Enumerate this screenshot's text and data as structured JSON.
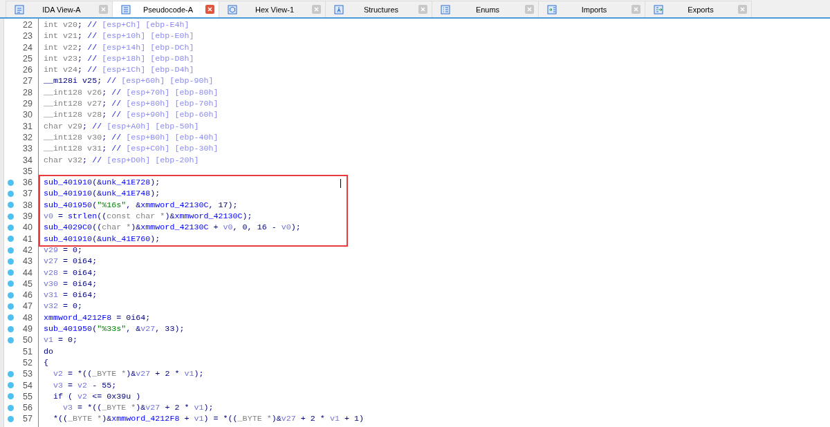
{
  "tabs": [
    {
      "label": "IDA View-A",
      "selected": false
    },
    {
      "label": "Pseudocode-A",
      "selected": true
    },
    {
      "label": "Hex View-1",
      "selected": false
    },
    {
      "label": "Structures",
      "selected": false
    },
    {
      "label": "Enums",
      "selected": false
    },
    {
      "label": "Imports",
      "selected": false
    },
    {
      "label": "Exports",
      "selected": false
    }
  ],
  "lines": [
    {
      "number": "22",
      "dot": false,
      "boxed": false,
      "tokens": [
        {
          "kind": "decl",
          "text": "int v20"
        },
        {
          "kind": "punct",
          "text": "; "
        },
        {
          "kind": "comment",
          "text": "// "
        },
        {
          "kind": "offset",
          "text": "[esp+Ch] [ebp-E4h]"
        }
      ]
    },
    {
      "number": "23",
      "dot": false,
      "boxed": false,
      "tokens": [
        {
          "kind": "decl",
          "text": "int v21"
        },
        {
          "kind": "punct",
          "text": "; "
        },
        {
          "kind": "comment",
          "text": "// "
        },
        {
          "kind": "offset",
          "text": "[esp+10h] [ebp-E0h]"
        }
      ]
    },
    {
      "number": "24",
      "dot": false,
      "boxed": false,
      "tokens": [
        {
          "kind": "decl",
          "text": "int v22"
        },
        {
          "kind": "punct",
          "text": "; "
        },
        {
          "kind": "comment",
          "text": "// "
        },
        {
          "kind": "offset",
          "text": "[esp+14h] [ebp-DCh]"
        }
      ]
    },
    {
      "number": "25",
      "dot": false,
      "boxed": false,
      "tokens": [
        {
          "kind": "decl",
          "text": "int v23"
        },
        {
          "kind": "punct",
          "text": "; "
        },
        {
          "kind": "comment",
          "text": "// "
        },
        {
          "kind": "offset",
          "text": "[esp+18h] [ebp-D8h]"
        }
      ]
    },
    {
      "number": "26",
      "dot": false,
      "boxed": false,
      "tokens": [
        {
          "kind": "decl",
          "text": "int v24"
        },
        {
          "kind": "punct",
          "text": "; "
        },
        {
          "kind": "comment",
          "text": "// "
        },
        {
          "kind": "offset",
          "text": "[esp+1Ch] [ebp-D4h]"
        }
      ]
    },
    {
      "number": "27",
      "dot": false,
      "boxed": false,
      "tokens": [
        {
          "kind": "punct",
          "text": "__m128i v25; "
        },
        {
          "kind": "comment",
          "text": "// "
        },
        {
          "kind": "offset",
          "text": "[esp+60h] [ebp-90h]"
        }
      ]
    },
    {
      "number": "28",
      "dot": false,
      "boxed": false,
      "tokens": [
        {
          "kind": "decl",
          "text": "__int128 v26"
        },
        {
          "kind": "punct",
          "text": "; "
        },
        {
          "kind": "comment",
          "text": "// "
        },
        {
          "kind": "offset",
          "text": "[esp+70h] [ebp-80h]"
        }
      ]
    },
    {
      "number": "29",
      "dot": false,
      "boxed": false,
      "tokens": [
        {
          "kind": "decl",
          "text": "__int128 v27"
        },
        {
          "kind": "punct",
          "text": "; "
        },
        {
          "kind": "comment",
          "text": "// "
        },
        {
          "kind": "offset",
          "text": "[esp+80h] [ebp-70h]"
        }
      ]
    },
    {
      "number": "30",
      "dot": false,
      "boxed": false,
      "tokens": [
        {
          "kind": "decl",
          "text": "__int128 v28"
        },
        {
          "kind": "punct",
          "text": "; "
        },
        {
          "kind": "comment",
          "text": "// "
        },
        {
          "kind": "offset",
          "text": "[esp+90h] [ebp-60h]"
        }
      ]
    },
    {
      "number": "31",
      "dot": false,
      "boxed": false,
      "tokens": [
        {
          "kind": "decl",
          "text": "char v29"
        },
        {
          "kind": "punct",
          "text": "; "
        },
        {
          "kind": "comment",
          "text": "// "
        },
        {
          "kind": "offset",
          "text": "[esp+A0h] [ebp-50h]"
        }
      ]
    },
    {
      "number": "32",
      "dot": false,
      "boxed": false,
      "tokens": [
        {
          "kind": "decl",
          "text": "__int128 v30"
        },
        {
          "kind": "punct",
          "text": "; "
        },
        {
          "kind": "comment",
          "text": "// "
        },
        {
          "kind": "offset",
          "text": "[esp+B0h] [ebp-40h]"
        }
      ]
    },
    {
      "number": "33",
      "dot": false,
      "boxed": false,
      "tokens": [
        {
          "kind": "decl",
          "text": "__int128 v31"
        },
        {
          "kind": "punct",
          "text": "; "
        },
        {
          "kind": "comment",
          "text": "// "
        },
        {
          "kind": "offset",
          "text": "[esp+C0h] [ebp-30h]"
        }
      ]
    },
    {
      "number": "34",
      "dot": false,
      "boxed": false,
      "tokens": [
        {
          "kind": "decl",
          "text": "char v32"
        },
        {
          "kind": "punct",
          "text": "; "
        },
        {
          "kind": "comment",
          "text": "// "
        },
        {
          "kind": "offset",
          "text": "[esp+D0h] [ebp-20h]"
        }
      ]
    },
    {
      "number": "35",
      "dot": false,
      "boxed": false
    },
    {
      "number": "36",
      "dot": true,
      "boxed": true,
      "tokens": [
        {
          "kind": "name",
          "text": "sub_401910"
        },
        {
          "kind": "punct",
          "text": "(&"
        },
        {
          "kind": "name",
          "text": "unk_41E728"
        },
        {
          "kind": "punct",
          "text": ");"
        }
      ]
    },
    {
      "number": "37",
      "dot": true,
      "boxed": true,
      "tokens": [
        {
          "kind": "name",
          "text": "sub_401910"
        },
        {
          "kind": "punct",
          "text": "(&"
        },
        {
          "kind": "name",
          "text": "unk_41E748"
        },
        {
          "kind": "punct",
          "text": ");"
        }
      ]
    },
    {
      "number": "38",
      "dot": true,
      "boxed": true,
      "tokens": [
        {
          "kind": "name",
          "text": "sub_401950"
        },
        {
          "kind": "punct",
          "text": "("
        },
        {
          "kind": "string",
          "text": "\"%16s\""
        },
        {
          "kind": "punct",
          "text": ", &"
        },
        {
          "kind": "name",
          "text": "xmmword_42130C"
        },
        {
          "kind": "punct",
          "text": ", 17);"
        }
      ]
    },
    {
      "number": "39",
      "dot": true,
      "boxed": true,
      "tokens": [
        {
          "kind": "var",
          "text": "v0"
        },
        {
          "kind": "punct",
          "text": " = "
        },
        {
          "kind": "name",
          "text": "strlen"
        },
        {
          "kind": "punct",
          "text": "(("
        },
        {
          "kind": "decl",
          "text": "const char *"
        },
        {
          "kind": "punct",
          "text": ")&"
        },
        {
          "kind": "name",
          "text": "xmmword_42130C"
        },
        {
          "kind": "punct",
          "text": ");"
        }
      ]
    },
    {
      "number": "40",
      "dot": true,
      "boxed": true,
      "tokens": [
        {
          "kind": "name",
          "text": "sub_4029C0"
        },
        {
          "kind": "punct",
          "text": "(("
        },
        {
          "kind": "decl",
          "text": "char *"
        },
        {
          "kind": "punct",
          "text": ")&"
        },
        {
          "kind": "name",
          "text": "xmmword_42130C"
        },
        {
          "kind": "punct",
          "text": " + "
        },
        {
          "kind": "var",
          "text": "v0"
        },
        {
          "kind": "punct",
          "text": ", 0, 16 - "
        },
        {
          "kind": "var",
          "text": "v0"
        },
        {
          "kind": "punct",
          "text": ");"
        }
      ]
    },
    {
      "number": "41",
      "dot": true,
      "boxed": true,
      "tokens": [
        {
          "kind": "name",
          "text": "sub_401910"
        },
        {
          "kind": "punct",
          "text": "(&"
        },
        {
          "kind": "name",
          "text": "unk_41E760"
        },
        {
          "kind": "punct",
          "text": ");"
        }
      ]
    },
    {
      "number": "42",
      "dot": true,
      "boxed": false,
      "tokens": [
        {
          "kind": "var",
          "text": "v29"
        },
        {
          "kind": "punct",
          "text": " = 0;"
        }
      ]
    },
    {
      "number": "43",
      "dot": true,
      "boxed": false,
      "tokens": [
        {
          "kind": "var",
          "text": "v27"
        },
        {
          "kind": "punct",
          "text": " = 0i64;"
        }
      ]
    },
    {
      "number": "44",
      "dot": true,
      "boxed": false,
      "tokens": [
        {
          "kind": "var",
          "text": "v28"
        },
        {
          "kind": "punct",
          "text": " = 0i64;"
        }
      ]
    },
    {
      "number": "45",
      "dot": true,
      "boxed": false,
      "tokens": [
        {
          "kind": "var",
          "text": "v30"
        },
        {
          "kind": "punct",
          "text": " = 0i64;"
        }
      ]
    },
    {
      "number": "46",
      "dot": true,
      "boxed": false,
      "tokens": [
        {
          "kind": "var",
          "text": "v31"
        },
        {
          "kind": "punct",
          "text": " = 0i64;"
        }
      ]
    },
    {
      "number": "47",
      "dot": true,
      "boxed": false,
      "tokens": [
        {
          "kind": "var",
          "text": "v32"
        },
        {
          "kind": "punct",
          "text": " = 0;"
        }
      ]
    },
    {
      "number": "48",
      "dot": true,
      "boxed": false,
      "tokens": [
        {
          "kind": "name",
          "text": "xmmword_4212F8"
        },
        {
          "kind": "punct",
          "text": " = 0i64;"
        }
      ]
    },
    {
      "number": "49",
      "dot": true,
      "boxed": false,
      "tokens": [
        {
          "kind": "name",
          "text": "sub_401950"
        },
        {
          "kind": "punct",
          "text": "("
        },
        {
          "kind": "string",
          "text": "\"%33s\""
        },
        {
          "kind": "punct",
          "text": ", &"
        },
        {
          "kind": "var",
          "text": "v27"
        },
        {
          "kind": "punct",
          "text": ", 33);"
        }
      ]
    },
    {
      "number": "50",
      "dot": true,
      "boxed": false,
      "tokens": [
        {
          "kind": "var",
          "text": "v1"
        },
        {
          "kind": "punct",
          "text": " = 0;"
        }
      ]
    },
    {
      "number": "51",
      "dot": false,
      "boxed": false,
      "tokens": [
        {
          "kind": "punct",
          "text": "do"
        }
      ]
    },
    {
      "number": "52",
      "dot": false,
      "boxed": false,
      "tokens": [
        {
          "kind": "punct",
          "text": "{"
        }
      ]
    },
    {
      "number": "53",
      "dot": true,
      "boxed": false,
      "tokens": [
        {
          "kind": "var",
          "text": "  v2"
        },
        {
          "kind": "punct",
          "text": " = *(("
        },
        {
          "kind": "decl",
          "text": "_BYTE *"
        },
        {
          "kind": "punct",
          "text": ")&"
        },
        {
          "kind": "var",
          "text": "v27"
        },
        {
          "kind": "punct",
          "text": " + 2 * "
        },
        {
          "kind": "var",
          "text": "v1"
        },
        {
          "kind": "punct",
          "text": ");"
        }
      ]
    },
    {
      "number": "54",
      "dot": true,
      "boxed": false,
      "tokens": [
        {
          "kind": "var",
          "text": "  v3"
        },
        {
          "kind": "punct",
          "text": " = "
        },
        {
          "kind": "var",
          "text": "v2"
        },
        {
          "kind": "punct",
          "text": " - 55;"
        }
      ]
    },
    {
      "number": "55",
      "dot": true,
      "boxed": false,
      "tokens": [
        {
          "kind": "punct",
          "text": "  if ( "
        },
        {
          "kind": "var",
          "text": "v2"
        },
        {
          "kind": "punct",
          "text": " <= 0x39u )"
        }
      ]
    },
    {
      "number": "56",
      "dot": true,
      "boxed": false,
      "tokens": [
        {
          "kind": "var",
          "text": "    v3"
        },
        {
          "kind": "punct",
          "text": " = *(("
        },
        {
          "kind": "decl",
          "text": "_BYTE *"
        },
        {
          "kind": "punct",
          "text": ")&"
        },
        {
          "kind": "var",
          "text": "v27"
        },
        {
          "kind": "punct",
          "text": " + 2 * "
        },
        {
          "kind": "var",
          "text": "v1"
        },
        {
          "kind": "punct",
          "text": ");"
        }
      ]
    },
    {
      "number": "57",
      "dot": true,
      "boxed": false,
      "tokens": [
        {
          "kind": "punct",
          "text": "  *(("
        },
        {
          "kind": "decl",
          "text": "_BYTE *"
        },
        {
          "kind": "punct",
          "text": ")&"
        },
        {
          "kind": "name",
          "text": "xmmword_4212F8"
        },
        {
          "kind": "punct",
          "text": " + "
        },
        {
          "kind": "var",
          "text": "v1"
        },
        {
          "kind": "punct",
          "text": ") = *(("
        },
        {
          "kind": "decl",
          "text": "_BYTE *"
        },
        {
          "kind": "punct",
          "text": ")&"
        },
        {
          "kind": "var",
          "text": "v27"
        },
        {
          "kind": "punct",
          "text": " + 2 * "
        },
        {
          "kind": "var",
          "text": "v1"
        },
        {
          "kind": "punct",
          "text": " + 1)"
        }
      ]
    }
  ]
}
